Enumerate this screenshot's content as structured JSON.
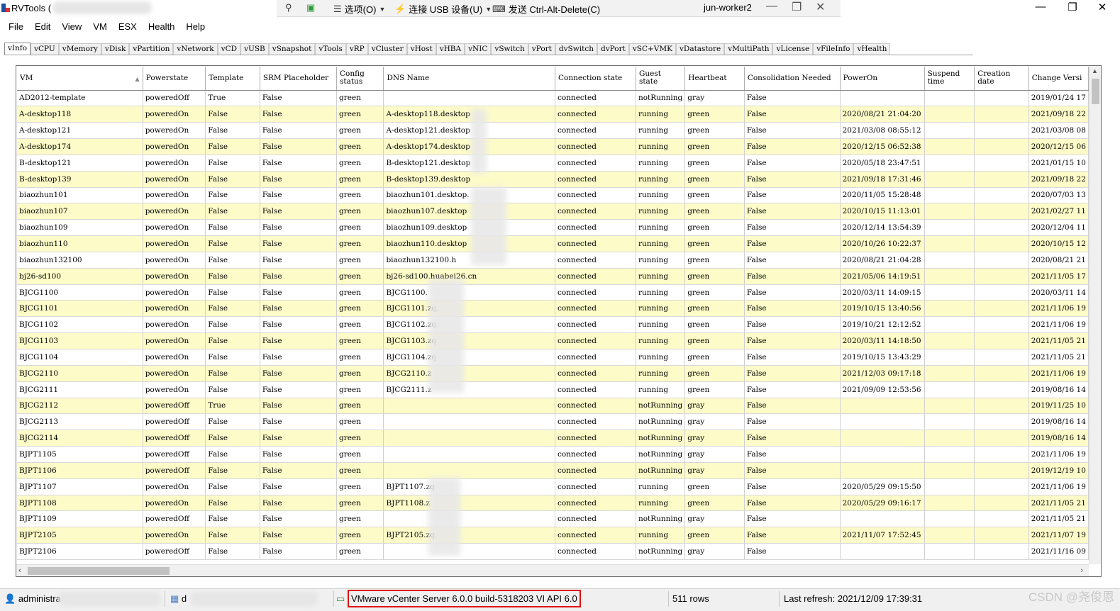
{
  "window": {
    "title": "RVTools (",
    "remote_bar": {
      "options_label": "选项(O)",
      "usb_label": "连接 USB 设备(U)",
      "cad_label": "发送 Ctrl-Alt-Delete(C)",
      "host_name": "jun-worker2"
    }
  },
  "menu": [
    "File",
    "Edit",
    "View",
    "VM",
    "ESX",
    "Health",
    "Help"
  ],
  "tabs": [
    "vInfo",
    "vCPU",
    "vMemory",
    "vDisk",
    "vPartition",
    "vNetwork",
    "vCD",
    "vUSB",
    "vSnapshot",
    "vTools",
    "vRP",
    "vCluster",
    "vHost",
    "vHBA",
    "vNIC",
    "vSwitch",
    "vPort",
    "dvSwitch",
    "dvPort",
    "vSC+VMK",
    "vDatastore",
    "vMultiPath",
    "vLicense",
    "vFileInfo",
    "vHealth"
  ],
  "active_tab": "vInfo",
  "grid": {
    "columns": [
      "VM",
      "Powerstate",
      "Template",
      "SRM Placeholder",
      "Config status",
      "DNS Name",
      "Connection state",
      "Guest state",
      "Heartbeat",
      "Consolidation Needed",
      "PowerOn",
      "Suspend time",
      "Creation date",
      "Change Versi"
    ],
    "rows": [
      [
        "AD2012-template",
        "poweredOff",
        "True",
        "False",
        "green",
        "",
        "connected",
        "notRunning",
        "gray",
        "False",
        "",
        "",
        "",
        "2019/01/24 17"
      ],
      [
        "A-desktop118",
        "poweredOn",
        "False",
        "False",
        "green",
        "A-desktop118.desktop",
        "connected",
        "running",
        "green",
        "False",
        "2020/08/21 21:04:20",
        "",
        "",
        "2021/09/18 22"
      ],
      [
        "A-desktop121",
        "poweredOn",
        "False",
        "False",
        "green",
        "A-desktop121.desktop",
        "connected",
        "running",
        "green",
        "False",
        "2021/03/08 08:55:12",
        "",
        "",
        "2021/03/08 08"
      ],
      [
        "A-desktop174",
        "poweredOn",
        "False",
        "False",
        "green",
        "A-desktop174.desktop",
        "connected",
        "running",
        "green",
        "False",
        "2020/12/15 06:52:38",
        "",
        "",
        "2020/12/15 06"
      ],
      [
        "B-desktop121",
        "poweredOn",
        "False",
        "False",
        "green",
        "B-desktop121.desktop",
        "connected",
        "running",
        "green",
        "False",
        "2020/05/18 23:47:51",
        "",
        "",
        "2021/01/15 10"
      ],
      [
        "B-desktop139",
        "poweredOn",
        "False",
        "False",
        "green",
        "B-desktop139.desktop",
        "connected",
        "running",
        "green",
        "False",
        "2021/09/18 17:31:46",
        "",
        "",
        "2021/09/18 22"
      ],
      [
        "biaozhun101",
        "poweredOn",
        "False",
        "False",
        "green",
        "biaozhun101.desktop.",
        "connected",
        "running",
        "green",
        "False",
        "2020/11/05 15:28:48",
        "",
        "",
        "2020/07/03 13"
      ],
      [
        "biaozhun107",
        "poweredOn",
        "False",
        "False",
        "green",
        "biaozhun107.desktop",
        "connected",
        "running",
        "green",
        "False",
        "2020/10/15 11:13:01",
        "",
        "",
        "2021/02/27 11"
      ],
      [
        "biaozhun109",
        "poweredOn",
        "False",
        "False",
        "green",
        "biaozhun109.desktop",
        "connected",
        "running",
        "green",
        "False",
        "2020/12/14 13:54:39",
        "",
        "",
        "2020/12/04 11"
      ],
      [
        "biaozhun110",
        "poweredOn",
        "False",
        "False",
        "green",
        "biaozhun110.desktop",
        "connected",
        "running",
        "green",
        "False",
        "2020/10/26 10:22:37",
        "",
        "",
        "2020/10/15 12"
      ],
      [
        "biaozhun132100",
        "poweredOn",
        "False",
        "False",
        "green",
        "biaozhun132100.h",
        "connected",
        "running",
        "green",
        "False",
        "2020/08/21 21:04:28",
        "",
        "",
        "2020/08/21 21"
      ],
      [
        "bj26-sd100",
        "poweredOn",
        "False",
        "False",
        "green",
        "bj26-sd100.huabei26.cn",
        "connected",
        "running",
        "green",
        "False",
        "2021/05/06 14:19:51",
        "",
        "",
        "2021/11/05 17"
      ],
      [
        "BJCG1100",
        "poweredOn",
        "False",
        "False",
        "green",
        "BJCG1100.",
        "connected",
        "running",
        "green",
        "False",
        "2020/03/11 14:09:15",
        "",
        "",
        "2020/03/11 14"
      ],
      [
        "BJCG1101",
        "poweredOn",
        "False",
        "False",
        "green",
        "BJCG1101.zq.",
        "connected",
        "running",
        "green",
        "False",
        "2019/10/15 13:40:56",
        "",
        "",
        "2021/11/06 19"
      ],
      [
        "BJCG1102",
        "poweredOn",
        "False",
        "False",
        "green",
        "BJCG1102.zq.",
        "connected",
        "running",
        "green",
        "False",
        "2019/10/21 12:12:52",
        "",
        "",
        "2021/11/06 19"
      ],
      [
        "BJCG1103",
        "poweredOn",
        "False",
        "False",
        "green",
        "BJCG1103.zq",
        "connected",
        "running",
        "green",
        "False",
        "2020/03/11 14:18:50",
        "",
        "",
        "2021/11/05 21"
      ],
      [
        "BJCG1104",
        "poweredOn",
        "False",
        "False",
        "green",
        "BJCG1104.zq",
        "connected",
        "running",
        "green",
        "False",
        "2019/10/15 13:43:29",
        "",
        "",
        "2021/11/05 21"
      ],
      [
        "BJCG2110",
        "poweredOn",
        "False",
        "False",
        "green",
        "BJCG2110.z",
        "connected",
        "running",
        "green",
        "False",
        "2021/12/03 09:17:18",
        "",
        "",
        "2021/11/06 19"
      ],
      [
        "BJCG2111",
        "poweredOn",
        "False",
        "False",
        "green",
        "BJCG2111.z",
        "connected",
        "running",
        "green",
        "False",
        "2021/09/09 12:53:56",
        "",
        "",
        "2019/08/16 14"
      ],
      [
        "BJCG2112",
        "poweredOff",
        "True",
        "False",
        "green",
        "",
        "connected",
        "notRunning",
        "gray",
        "False",
        "",
        "",
        "",
        "2019/11/25 10"
      ],
      [
        "BJCG2113",
        "poweredOff",
        "False",
        "False",
        "green",
        "",
        "connected",
        "notRunning",
        "gray",
        "False",
        "",
        "",
        "",
        "2019/08/16 14"
      ],
      [
        "BJCG2114",
        "poweredOff",
        "False",
        "False",
        "green",
        "",
        "connected",
        "notRunning",
        "gray",
        "False",
        "",
        "",
        "",
        "2019/08/16 14"
      ],
      [
        "BJPT1105",
        "poweredOff",
        "False",
        "False",
        "green",
        "",
        "connected",
        "notRunning",
        "gray",
        "False",
        "",
        "",
        "",
        "2021/11/06 19"
      ],
      [
        "BJPT1106",
        "poweredOff",
        "False",
        "False",
        "green",
        "",
        "connected",
        "notRunning",
        "gray",
        "False",
        "",
        "",
        "",
        "2019/12/19 10"
      ],
      [
        "BJPT1107",
        "poweredOn",
        "False",
        "False",
        "green",
        "BJPT1107.zq",
        "connected",
        "running",
        "green",
        "False",
        "2020/05/29 09:15:50",
        "",
        "",
        "2021/11/06 19"
      ],
      [
        "BJPT1108",
        "poweredOn",
        "False",
        "False",
        "green",
        "BJPT1108.z",
        "connected",
        "running",
        "green",
        "False",
        "2020/05/29 09:16:17",
        "",
        "",
        "2021/11/05 21"
      ],
      [
        "BJPT1109",
        "poweredOff",
        "False",
        "False",
        "green",
        "",
        "connected",
        "notRunning",
        "gray",
        "False",
        "",
        "",
        "",
        "2021/11/05 21"
      ],
      [
        "BJPT2105",
        "poweredOn",
        "False",
        "False",
        "green",
        "BJPT2105.zq.",
        "connected",
        "running",
        "green",
        "False",
        "2021/11/07 17:52:45",
        "",
        "",
        "2021/11/07 19"
      ],
      [
        "BJPT2106",
        "poweredOff",
        "False",
        "False",
        "green",
        "",
        "connected",
        "notRunning",
        "gray",
        "False",
        "",
        "",
        "",
        "2021/11/16 09"
      ]
    ]
  },
  "statusbar": {
    "user": "administra",
    "second": "d",
    "server": "VMware vCenter Server 6.0.0 build-5318203  VI API 6.0",
    "rows": "511 rows",
    "refresh": "Last refresh: 2021/12/09 17:39:31"
  },
  "watermark": "CSDN @尧俊恩",
  "colors": {
    "row_alt": "#fdfbc8",
    "highlight": "#e01010"
  }
}
